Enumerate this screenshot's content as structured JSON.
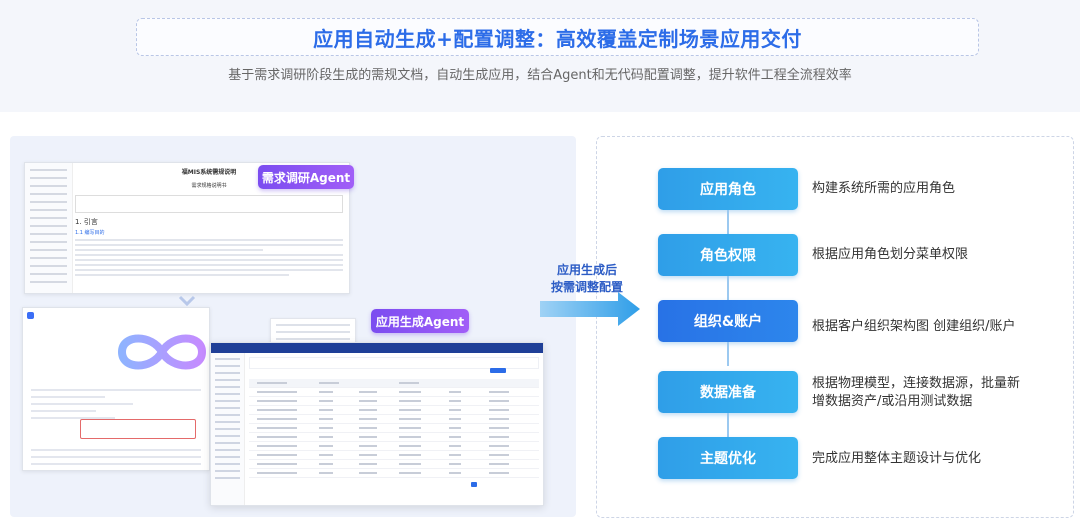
{
  "header": {
    "title": "应用自动生成+配置调整：高效覆盖定制场景应用交付",
    "subtitle": "基于需求调研阶段生成的需规文档，自动生成应用，结合Agent和无代码配置调整，提升软件工程全流程效率"
  },
  "left": {
    "research_agent_label": "需求调研Agent",
    "gen_agent_label": "应用生成Agent",
    "doc": {
      "title": "福MIS系统需规说明",
      "subtitle": "需求规格说明书",
      "section": "1. 引言",
      "subsection": "1.1 编写目的"
    }
  },
  "middle": {
    "arrow_label_line1": "应用生成后",
    "arrow_label_line2": "按需调整配置"
  },
  "steps": [
    {
      "label": "应用角色",
      "desc": "构建系统所需的应用角色"
    },
    {
      "label": "角色权限",
      "desc": "根据应用角色划分菜单权限"
    },
    {
      "label": "组织&账户",
      "desc": "根据客户组织架构图 创建组织/账户"
    },
    {
      "label": "数据准备",
      "desc": "根据物理模型，连接数据源，批量新增数据资产/或沿用测试数据"
    },
    {
      "label": "主题优化",
      "desc": "完成应用整体主题设计与优化"
    }
  ],
  "colors": {
    "title": "#2c6ce8",
    "step": "#2f9ee8",
    "step_active": "#2872e6",
    "agent_tag": "#8a55f3"
  }
}
